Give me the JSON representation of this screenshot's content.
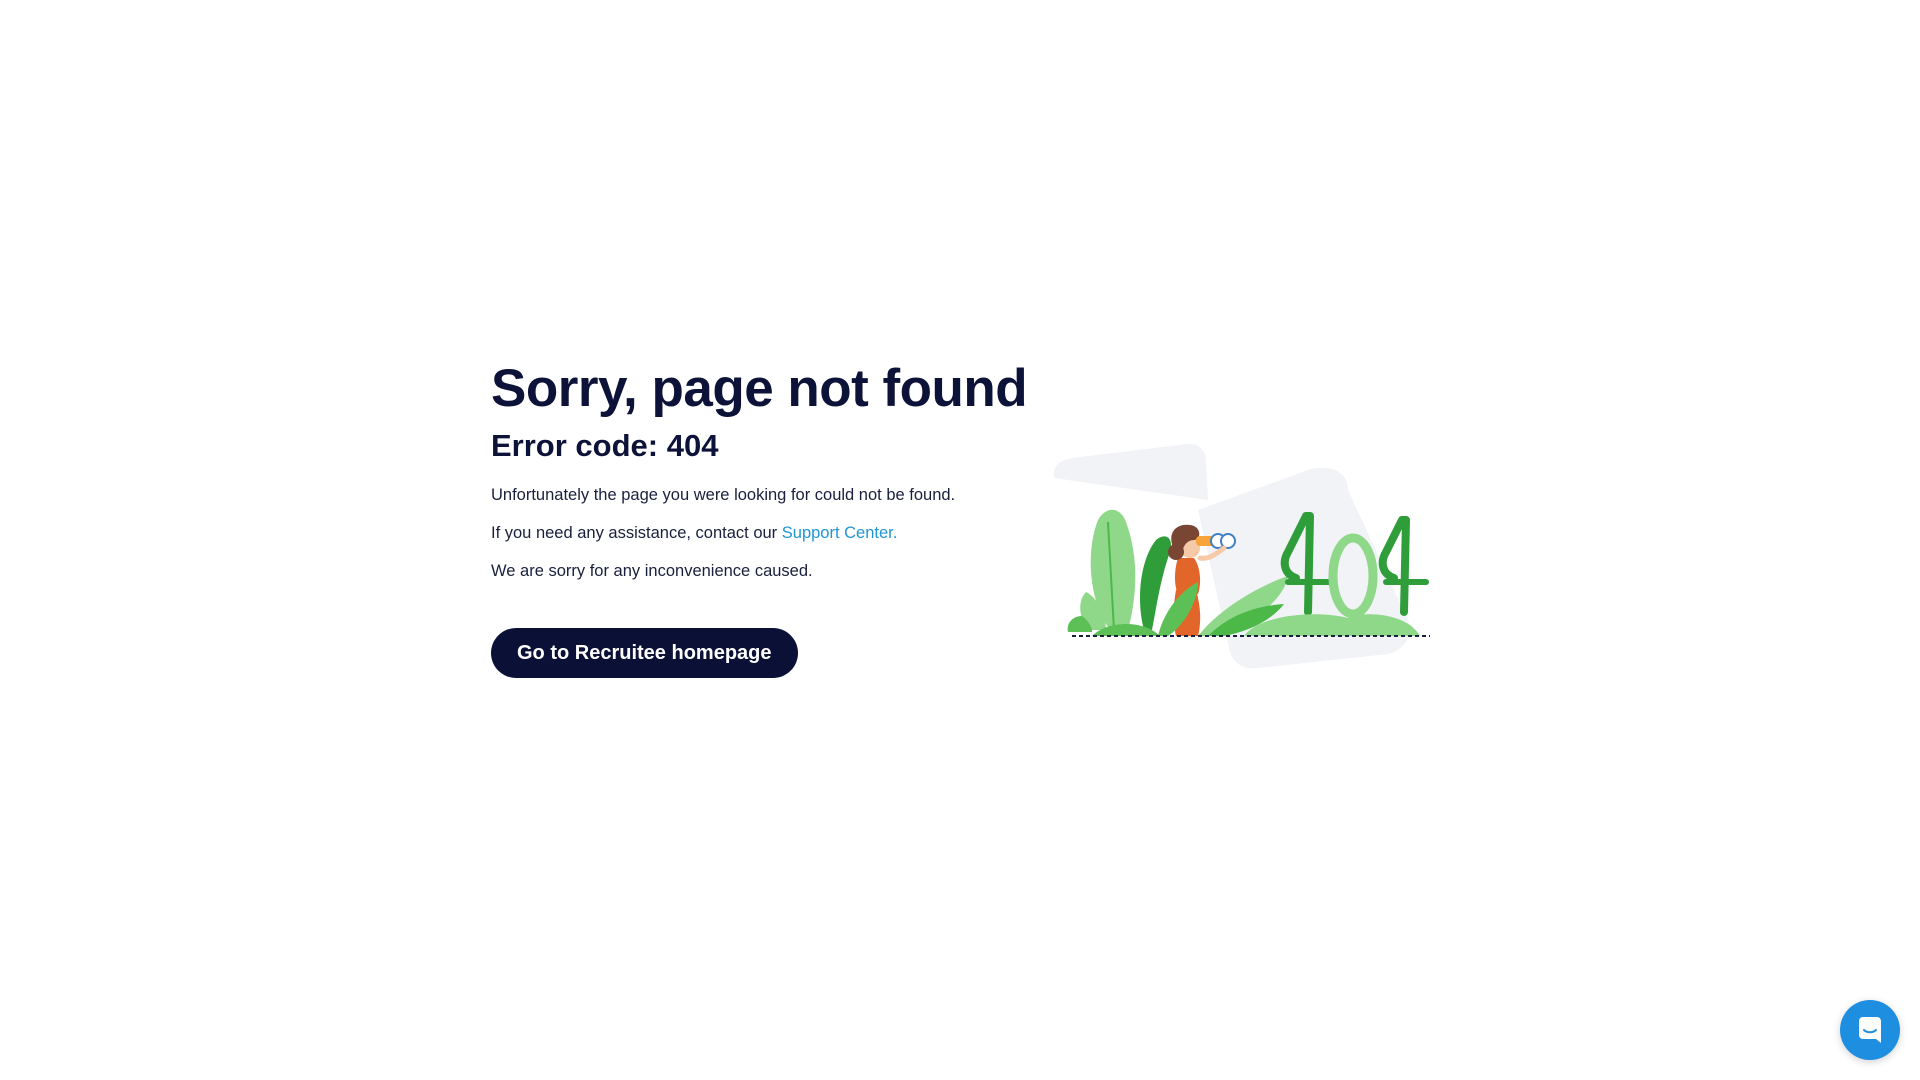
{
  "page": {
    "title": "Sorry, page not found",
    "error_code": "Error code: 404",
    "line1": "Unfortunately the page you were looking for could not be found.",
    "line2_prefix": "If you need any assistance, contact our ",
    "line2_link": "Support Center",
    "line2_suffix": ".",
    "line3": "We are sorry for any inconvenience caused.",
    "cta_label": "Go to Recruitee homepage"
  },
  "illustration": {
    "icon": "person-with-binoculars-404-illustration",
    "caption_digits": "404"
  },
  "chat": {
    "icon": "chat-icon"
  },
  "colors": {
    "heading": "#0d1238",
    "link": "#2196d3",
    "button_bg": "#0b1036",
    "button_text": "#ffffff",
    "chat_bg": "#1e8fe0",
    "plant_dark": "#2f9e3a",
    "plant_light": "#8fd88a"
  }
}
